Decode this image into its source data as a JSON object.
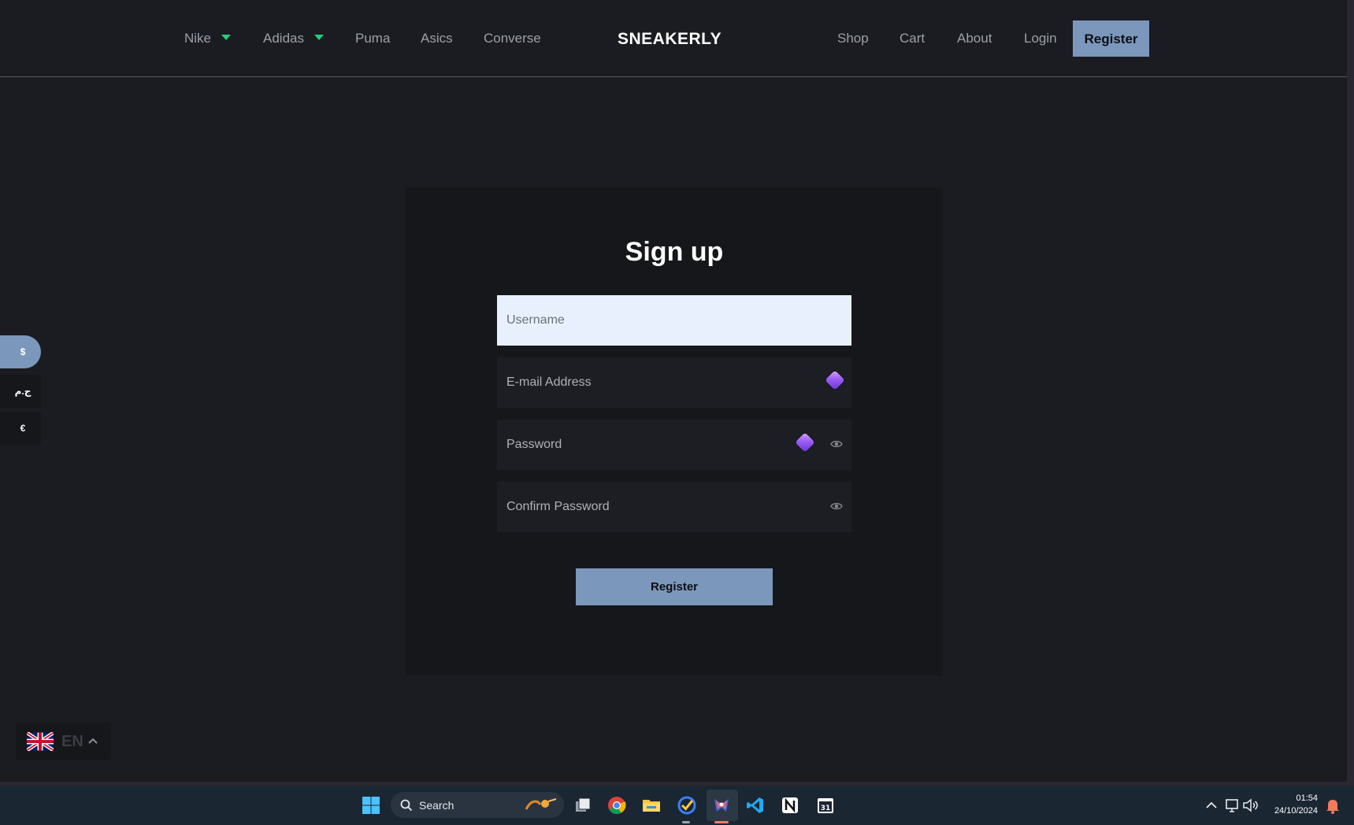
{
  "nav": {
    "left_links": [
      {
        "label": "Nike",
        "has_dropdown": true
      },
      {
        "label": "Adidas",
        "has_dropdown": true
      },
      {
        "label": "Puma",
        "has_dropdown": false
      },
      {
        "label": "Asics",
        "has_dropdown": false
      },
      {
        "label": "Converse",
        "has_dropdown": false
      }
    ],
    "brand": "SNEAKERLY",
    "right_links": [
      {
        "label": "Shop"
      },
      {
        "label": "Cart"
      },
      {
        "label": "About"
      },
      {
        "label": "Login"
      }
    ],
    "register_label": "Register"
  },
  "form": {
    "title": "Sign up",
    "username_placeholder": "Username",
    "email_placeholder": "E-mail Address",
    "password_placeholder": "Password",
    "confirm_placeholder": "Confirm Password",
    "submit_label": "Register"
  },
  "currency": {
    "options": [
      "$",
      "ج.م",
      "€"
    ],
    "selected": "$"
  },
  "language": {
    "code": "EN",
    "flag": "uk-flag-icon"
  },
  "taskbar": {
    "search_label": "Search",
    "time": "01:54",
    "date": "24/10/2024"
  },
  "colors": {
    "accent": "#7b97bb",
    "background": "#1b1c21",
    "card": "#16171b",
    "dropdown_caret": "#22d07a"
  }
}
